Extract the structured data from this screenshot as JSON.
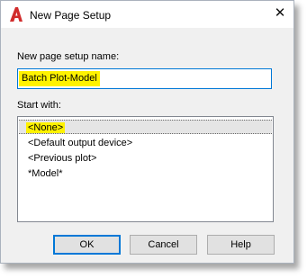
{
  "window": {
    "title": "New Page Setup",
    "close_glyph": "✕",
    "icon": "autocad-a-icon",
    "icon_color": "#d12c2c"
  },
  "form": {
    "name_label": "New page setup name:",
    "name_value": "Batch Plot-Model",
    "start_with_label": "Start with:"
  },
  "list": {
    "items": [
      {
        "label": "<None>",
        "selected": true
      },
      {
        "label": "<Default output device>",
        "selected": false
      },
      {
        "label": "<Previous plot>",
        "selected": false
      },
      {
        "label": "*Model*",
        "selected": false
      }
    ],
    "highlight_color": "#fff200"
  },
  "buttons": {
    "ok": "OK",
    "cancel": "Cancel",
    "help": "Help"
  }
}
